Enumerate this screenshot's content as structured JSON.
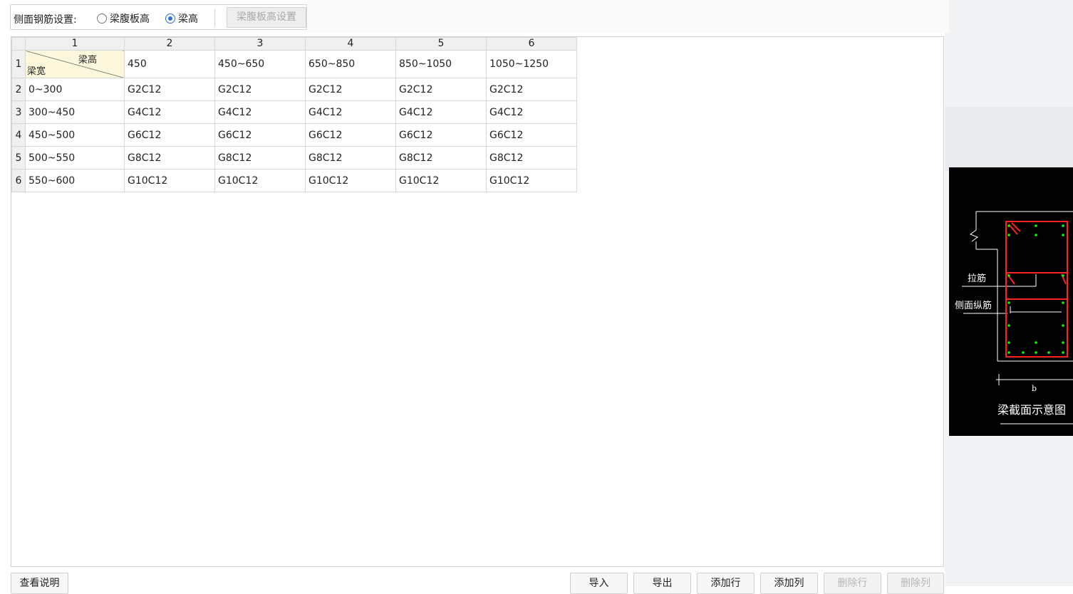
{
  "toolbar": {
    "label": "侧面钢筋设置:",
    "radio_web_height": "梁腹板高",
    "radio_beam_height": "梁高",
    "selected": "梁高",
    "web_height_settings": "梁腹板高设置"
  },
  "table": {
    "col_headers": [
      "1",
      "2",
      "3",
      "4",
      "5",
      "6"
    ],
    "corner": {
      "top": "梁高",
      "bottom": "梁宽"
    },
    "header_values": [
      "450",
      "450~650",
      "650~850",
      "850~1050",
      "1050~1250"
    ],
    "rows": [
      {
        "num": "2",
        "width": "0~300",
        "cells": [
          "G2C12",
          "G2C12",
          "G2C12",
          "G2C12",
          "G2C12"
        ]
      },
      {
        "num": "3",
        "width": "300~450",
        "cells": [
          "G4C12",
          "G4C12",
          "G4C12",
          "G4C12",
          "G4C12"
        ]
      },
      {
        "num": "4",
        "width": "450~500",
        "cells": [
          "G6C12",
          "G6C12",
          "G6C12",
          "G6C12",
          "G6C12"
        ]
      },
      {
        "num": "5",
        "width": "500~550",
        "cells": [
          "G8C12",
          "G8C12",
          "G8C12",
          "G8C12",
          "G8C12"
        ]
      },
      {
        "num": "6",
        "width": "550~600",
        "cells": [
          "G10C12",
          "G10C12",
          "G10C12",
          "G10C12",
          "G10C12"
        ]
      }
    ],
    "row1_num": "1"
  },
  "diagram": {
    "tie_bar": "拉筋",
    "side_bar": "侧面纵筋",
    "b_label": "b",
    "caption": "梁截面示意图"
  },
  "buttons": {
    "view_notes": "查看说明",
    "import": "导入",
    "export": "导出",
    "add_row": "添加行",
    "add_col": "添加列",
    "delete_row": "删除行",
    "delete_col": "删除列"
  },
  "colors": {
    "accent": "#2a6fdb",
    "rebar": "#ff2020",
    "dot": "#00ff00"
  }
}
